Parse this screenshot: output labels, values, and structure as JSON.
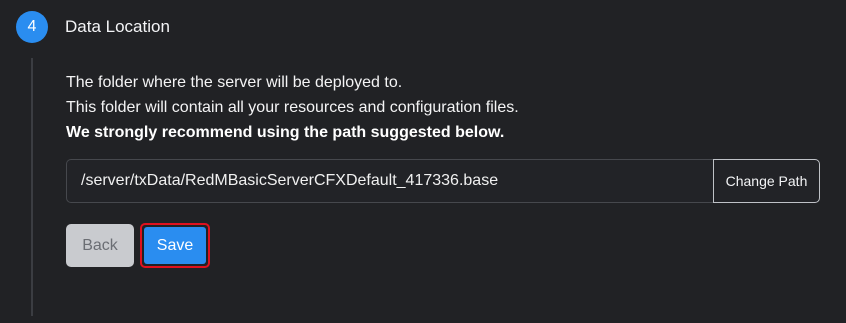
{
  "step": {
    "number": "4",
    "title": "Data Location"
  },
  "description": {
    "line1": "The folder where the server will be deployed to.",
    "line2": "This folder will contain all your resources and configuration files.",
    "line3": "We strongly recommend using the path suggested below."
  },
  "path_field": {
    "value": "/server/txData/RedMBasicServerCFXDefault_417336.base",
    "change_label": "Change Path"
  },
  "actions": {
    "back_label": "Back",
    "save_label": "Save"
  },
  "colors": {
    "background": "#212225",
    "accent": "#2a8df0",
    "highlight_border": "#e0111e",
    "back_button": "#c9cbcf"
  }
}
